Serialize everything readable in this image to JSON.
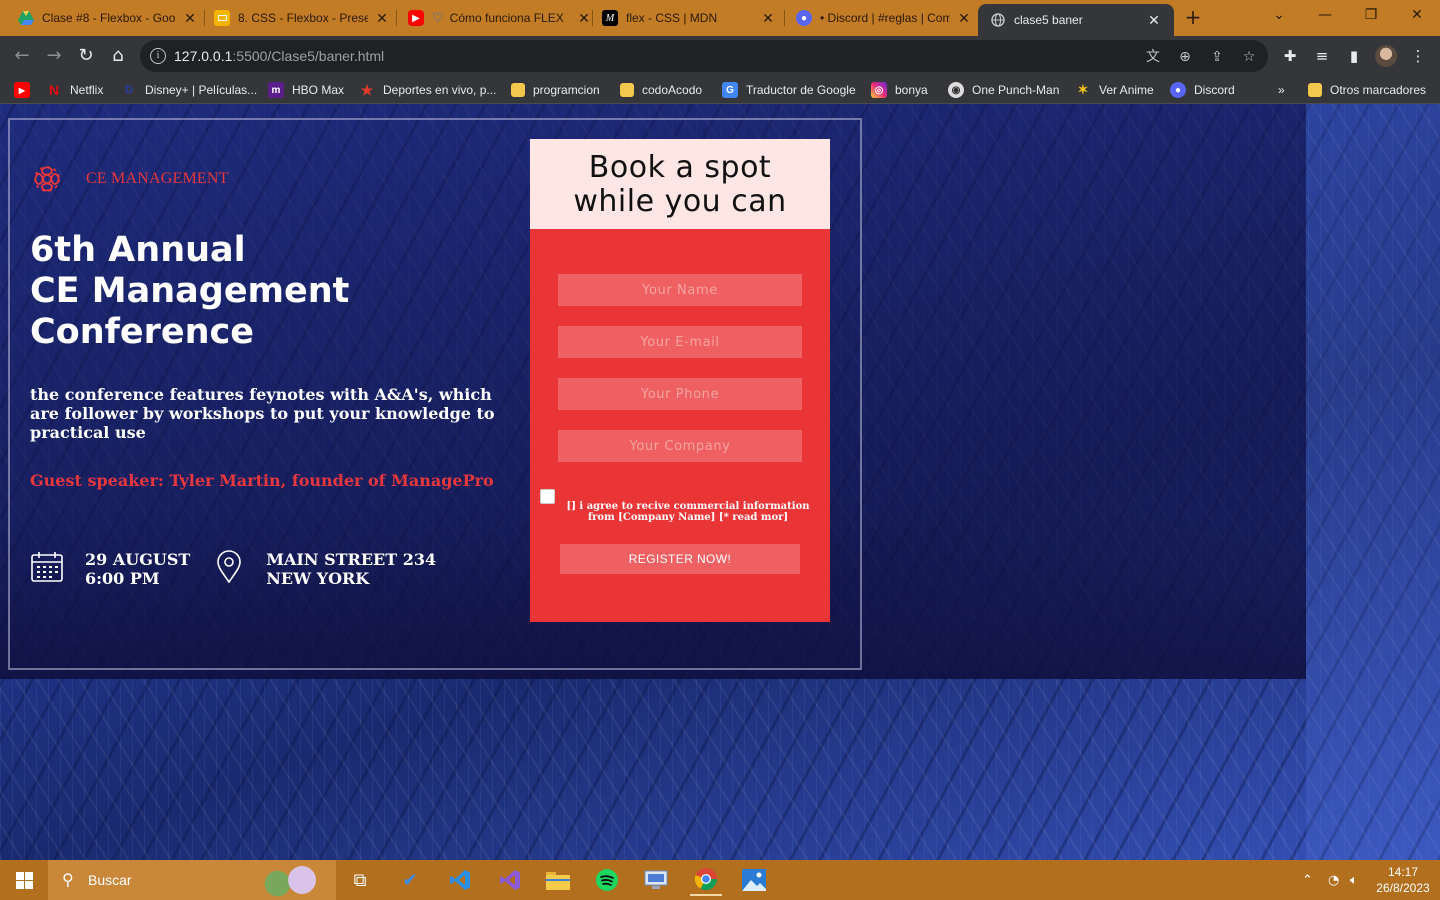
{
  "browser": {
    "tabs": [
      {
        "label": "Clase #8 - Flexbox - Goo",
        "icon": "google-drive-icon",
        "color": "#f3b400"
      },
      {
        "label": "8. CSS - Flexbox - Presen",
        "icon": "google-slides-icon",
        "color": "#f4b400"
      },
      {
        "label": "Cómo funciona FLEX",
        "icon": "youtube-heart-icon",
        "color": "#ff0000"
      },
      {
        "label": "flex - CSS | MDN",
        "icon": "mdn-icon",
        "color": "#000000"
      },
      {
        "label": "• Discord | #reglas | Com",
        "icon": "discord-icon",
        "color": "#5865f2"
      },
      {
        "label": "clase5 baner",
        "icon": "globe-icon",
        "color": "#9aa0a6",
        "active": true
      }
    ],
    "url_host": "127.0.0.1",
    "url_path": ":5500/Clase5/baner.html",
    "bookmarks": [
      {
        "label": "Netflix",
        "icon": "netflix-icon"
      },
      {
        "label": "Disney+ | Películas...",
        "icon": "disney-icon"
      },
      {
        "label": "HBO Max",
        "icon": "hbo-icon"
      },
      {
        "label": "Deportes en vivo, p...",
        "icon": "star-icon"
      },
      {
        "label": "programcion",
        "icon": "folder-icon"
      },
      {
        "label": "codoAcodo",
        "icon": "folder-icon"
      },
      {
        "label": "Traductor de Google",
        "icon": "translate-icon"
      },
      {
        "label": "bonya",
        "icon": "instagram-icon"
      },
      {
        "label": "One Punch-Man",
        "icon": "onepunch-icon"
      },
      {
        "label": "Ver Anime",
        "icon": "anime-icon"
      },
      {
        "label": "Discord",
        "icon": "discord-icon"
      }
    ],
    "bookmarks_more": "»",
    "other_bookmarks": "Otros marcadores"
  },
  "page": {
    "brand": "CE MANAGEMENT",
    "title_lines": [
      "6th Annual",
      "CE Management",
      "Conference"
    ],
    "description": "the conference features feynotes with A&A's, which are follower by workshops to put your knowledge to practical use",
    "speaker": "Guest speaker: Tyler Martin, founder of ManagePro",
    "date_line1": "29 AUGUST",
    "date_line2": "6:00 PM",
    "address_line1": "MAIN STREET 234",
    "address_line2": "NEW YORK",
    "accent_color": "#e8373d"
  },
  "form": {
    "heading_line1": "Book a spot",
    "heading_line2": "while you can",
    "name_placeholder": "Your Name",
    "email_placeholder": "Your E-mail",
    "phone_placeholder": "Your Phone",
    "company_placeholder": "Your Company",
    "consent": "[] i agree to recive commercial information from [Company Name] [* read mor]",
    "register_label": "REGISTER NOW!",
    "card_color": "#ea3537",
    "head_color": "#fde6e4"
  },
  "taskbar": {
    "search_placeholder": "Buscar",
    "time": "14:17",
    "date": "26/8/2023"
  }
}
